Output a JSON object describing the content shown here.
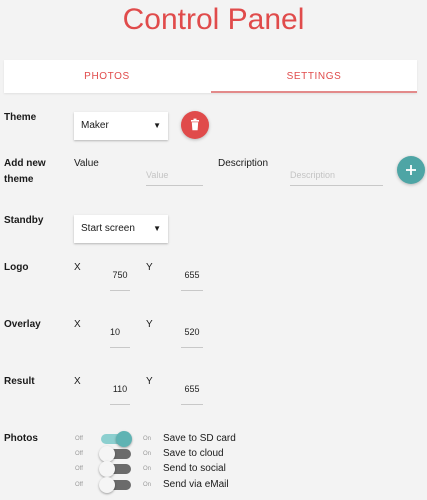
{
  "app": {
    "title": "Control Panel"
  },
  "tabs": [
    {
      "label": "PHOTOS",
      "active": false
    },
    {
      "label": "SETTINGS",
      "active": true
    }
  ],
  "settings": {
    "theme": {
      "label": "Theme",
      "selected": "Maker",
      "delete_icon": "trash-icon"
    },
    "add_theme": {
      "label_line1": "Add new",
      "label_line2": "theme",
      "value_label": "Value",
      "value_placeholder": "Value",
      "description_label": "Description",
      "description_placeholder": "Description",
      "add_icon": "plus-icon"
    },
    "standby": {
      "label": "Standby",
      "selected": "Start screen"
    },
    "logo": {
      "label": "Logo",
      "x_label": "X",
      "x": "750",
      "y_label": "Y",
      "y": "655"
    },
    "overlay": {
      "label": "Overlay",
      "x_label": "X",
      "x": "10",
      "y_label": "Y",
      "y": "520"
    },
    "result": {
      "label": "Result",
      "x_label": "X",
      "x": "110",
      "y_label": "Y",
      "y": "655"
    },
    "photos": {
      "label": "Photos",
      "off_text": "Off",
      "on_text": "On",
      "toggles": [
        {
          "label": "Save to SD card",
          "on": true
        },
        {
          "label": "Save to cloud",
          "on": false
        },
        {
          "label": "Send to social",
          "on": false
        },
        {
          "label": "Send via eMail",
          "on": false
        }
      ]
    }
  },
  "colors": {
    "accent": "#e04b4b",
    "delete_button": "#e04b4b",
    "add_button": "#4ea5a5",
    "toggle_on_track": "#8ccfcf",
    "toggle_on_knob": "#5fb3b3",
    "toggle_off_track": "#6b6b6b",
    "toggle_off_knob": "#f5f5f5"
  }
}
